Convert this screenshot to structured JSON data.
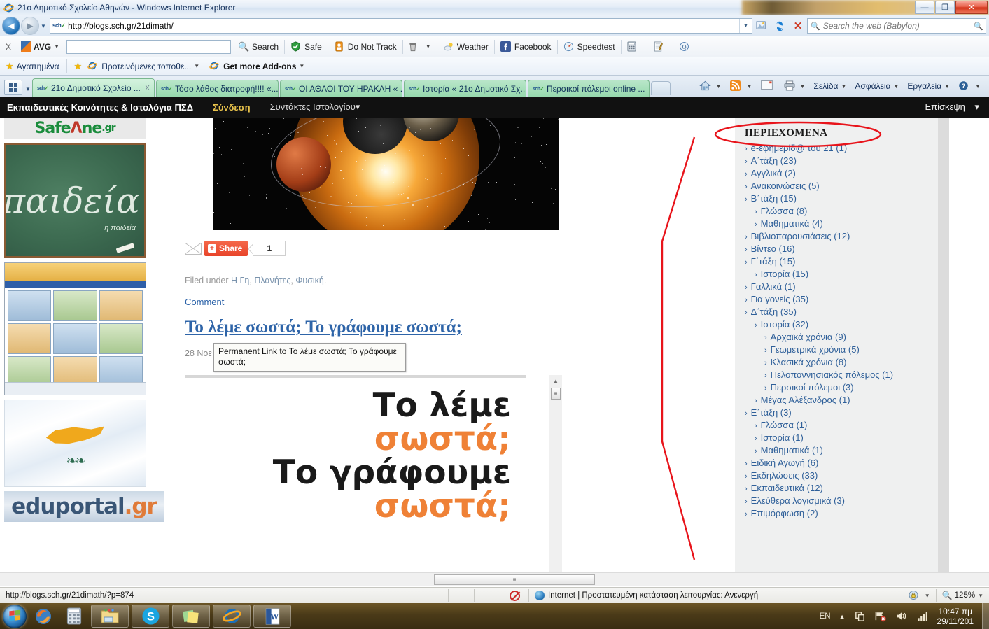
{
  "window": {
    "title": "21ο Δημοτικό Σχολείο Αθηνών - Windows Internet Explorer",
    "minimize": "—",
    "maximize": "❐",
    "close": "✕"
  },
  "address_bar": {
    "url": "http://blogs.sch.gr/21dimath/",
    "favicon_label": "sch",
    "favicon_accent": "gr",
    "dropdown": "▼",
    "compat_icon": "compatibility-view-icon",
    "refresh_icon": "refresh-icon",
    "stop_icon": "stop-icon",
    "search_placeholder": "Search the web (Babylon)",
    "search_value": "",
    "go_icon": "search-go-icon"
  },
  "avg_toolbar": {
    "close_label": "X",
    "brand": "AVG",
    "brand_caret": "▼",
    "input_value": "",
    "items": [
      {
        "label": "Search",
        "icon": "magnifier-icon",
        "caret": ""
      },
      {
        "label": "Safe",
        "icon": "shield-icon",
        "caret": ""
      },
      {
        "label": "Do Not Track",
        "icon": "do-not-track-icon",
        "caret": ""
      },
      {
        "label": "",
        "icon": "trash-icon",
        "caret": "▼"
      },
      {
        "label": "Weather",
        "icon": "weather-icon",
        "caret": ""
      },
      {
        "label": "Facebook",
        "icon": "facebook-icon",
        "caret": ""
      },
      {
        "label": "Speedtest",
        "icon": "speedtest-icon",
        "caret": ""
      },
      {
        "label": "",
        "icon": "calculator-icon",
        "caret": ""
      },
      {
        "label": "",
        "icon": "notepad-icon",
        "caret": ""
      },
      {
        "label": "",
        "icon": "translate-icon",
        "caret": ""
      }
    ]
  },
  "favorites_bar": {
    "favorites_label": "Αγαπημένα",
    "suggested_sites": "Προτεινόμενες τοποθε...",
    "suggested_caret": "▼",
    "get_addons": "Get more Add-ons",
    "get_addons_caret": "▼"
  },
  "tabs": {
    "quick_tabs_caret": "▼",
    "items": [
      {
        "label": "21ο Δημοτικό Σχολείο ...",
        "active": true,
        "close": "X"
      },
      {
        "label": "Τόσο λάθος διατροφή!!!! «...",
        "active": false,
        "close": ""
      },
      {
        "label": "ΟΙ ΑΘΛΟΙ ΤΟΥ ΗΡΑΚΛΗ « ...",
        "active": false,
        "close": ""
      },
      {
        "label": "Ιστορία « 21ο Δημοτικό Σχ...",
        "active": false,
        "close": ""
      },
      {
        "label": "Περσικοί πόλεμοι online ...",
        "active": false,
        "close": ""
      }
    ]
  },
  "command_bar": {
    "home_icon": "home-icon",
    "home_caret": "▼",
    "feeds_icon": "rss-icon",
    "feeds_caret": "▼",
    "mail_icon": "mail-icon",
    "print_icon": "printer-icon",
    "print_caret": "▼",
    "page": "Σελίδα",
    "page_caret": "▼",
    "safety": "Ασφάλεια",
    "safety_caret": "▼",
    "tools": "Εργαλεία",
    "tools_caret": "▼",
    "help_icon": "help-icon",
    "help_caret": "▼"
  },
  "wp_admin_bar": {
    "brand": "Εκπαιδευτικές Κοινότητες & Ιστολόγια ΠΣΔ",
    "login": "Σύνδεση",
    "authors": "Συντάκτες Ιστολογίου",
    "authors_caret": "▾",
    "visit": "Επίσκεψη",
    "visit_caret": "▾"
  },
  "left_sidebar": {
    "banner1": {
      "name": "saferinternet-banner",
      "text_main": "SafeLine",
      "text_suffix": ".gr"
    },
    "banner2": {
      "name": "paideia-chalkboard-banner",
      "word": "παιδεία",
      "sub": "η παιδεία"
    },
    "banner3": {
      "name": "school-site-screenshot-banner"
    },
    "banner4": {
      "name": "cyprus-flag-banner"
    },
    "banner5": {
      "name": "eduportal-banner",
      "text": "eduportal",
      "suffix": ".gr"
    }
  },
  "post": {
    "featured_image_alt": "planets-and-sun-space-image",
    "share_button": "Share",
    "share_plus": "+",
    "share_count": "1",
    "filed_under_label": "Filed under",
    "categories": [
      "Η Γη",
      "Πλανήτες",
      "Φυσική"
    ],
    "comment_link": "Comment",
    "title": "Το λέμε σωστά; Το γράφουμε σωστά;",
    "date": "28 Νοε",
    "tooltip": "Permanent Link to Το λέμε σωστά; Το γράφουμε σωστά;",
    "embedded_image": {
      "line1": "Το λέμε",
      "line2": "σωστά;",
      "line3": "Το γράφουμε",
      "line4": "σωστά;"
    }
  },
  "right_sidebar": {
    "title": "ΠΕΡΙΕΧΟΜΕΝΑ",
    "chevron": "›",
    "items": [
      {
        "label": "e-εφημερίδ@ του 21 (1)",
        "level": 0
      },
      {
        "label": "Α΄τάξη (23)",
        "level": 0
      },
      {
        "label": "Αγγλικά (2)",
        "level": 0
      },
      {
        "label": "Ανακοινώσεις (5)",
        "level": 0
      },
      {
        "label": "Β΄τάξη (15)",
        "level": 0
      },
      {
        "label": "Γλώσσα (8)",
        "level": 1
      },
      {
        "label": "Μαθηματικά (4)",
        "level": 1
      },
      {
        "label": "Βιβλιοπαρουσιάσεις (12)",
        "level": 0
      },
      {
        "label": "Βίντεο (16)",
        "level": 0
      },
      {
        "label": "Γ΄τάξη (15)",
        "level": 0
      },
      {
        "label": "Ιστορία (15)",
        "level": 1
      },
      {
        "label": "Γαλλικά (1)",
        "level": 0
      },
      {
        "label": "Για γονείς (35)",
        "level": 0
      },
      {
        "label": "Δ΄τάξη (35)",
        "level": 0
      },
      {
        "label": "Ιστορία (32)",
        "level": 1
      },
      {
        "label": "Αρχαϊκά χρόνια (9)",
        "level": 2
      },
      {
        "label": "Γεωμετρικά χρόνια (5)",
        "level": 2
      },
      {
        "label": "Κλασικά χρόνια (8)",
        "level": 2
      },
      {
        "label": "Πελοποννησιακός πόλεμος (1)",
        "level": 2
      },
      {
        "label": "Περσικοί πόλεμοι (3)",
        "level": 2
      },
      {
        "label": "Μέγας Αλέξανδρος (1)",
        "level": 1
      },
      {
        "label": "Ε΄τάξη (3)",
        "level": 0
      },
      {
        "label": "Γλώσσα (1)",
        "level": 1
      },
      {
        "label": "Ιστορία (1)",
        "level": 1
      },
      {
        "label": "Μαθηματικά (1)",
        "level": 1
      },
      {
        "label": "Ειδική Αγωγή (6)",
        "level": 0
      },
      {
        "label": "Εκδηλώσεις (33)",
        "level": 0
      },
      {
        "label": "Εκπαιδευτικά (12)",
        "level": 0
      },
      {
        "label": "Ελεύθερα λογισμικά (3)",
        "level": 0
      },
      {
        "label": "Επιμόρφωση (2)",
        "level": 0
      }
    ]
  },
  "annotation": {
    "color": "#e8141b",
    "description": "red-ellipse-and-brace-pointing-to-contents"
  },
  "status_bar": {
    "url": "http://blogs.sch.gr/21dimath/?p=874",
    "zone": "Internet | Προστατευμένη κατάσταση λειτουργίας: Ανενεργή",
    "zoom": "125%",
    "zoom_caret": "▼",
    "privacy_icon": "blocked-cookie-icon",
    "security_icon": "security-lock-icon",
    "security_caret": "▼"
  },
  "taskbar": {
    "start": "start-orb",
    "quick_launch": [
      "firefox-icon",
      "calculator-icon",
      "explorer-folder-icon"
    ],
    "windows": [
      "skype-icon",
      "sticky-notes-icon",
      "internet-explorer-icon",
      "word-icon"
    ],
    "tray": {
      "language": "EN",
      "expand_caret": "▲",
      "action_center_icon": "action-center-icon",
      "network_icon": "network-error-icon",
      "volume_icon": "volume-icon",
      "signal_icon": "signal-icon",
      "time": "10:47 πμ",
      "date": "29/11/201"
    }
  }
}
